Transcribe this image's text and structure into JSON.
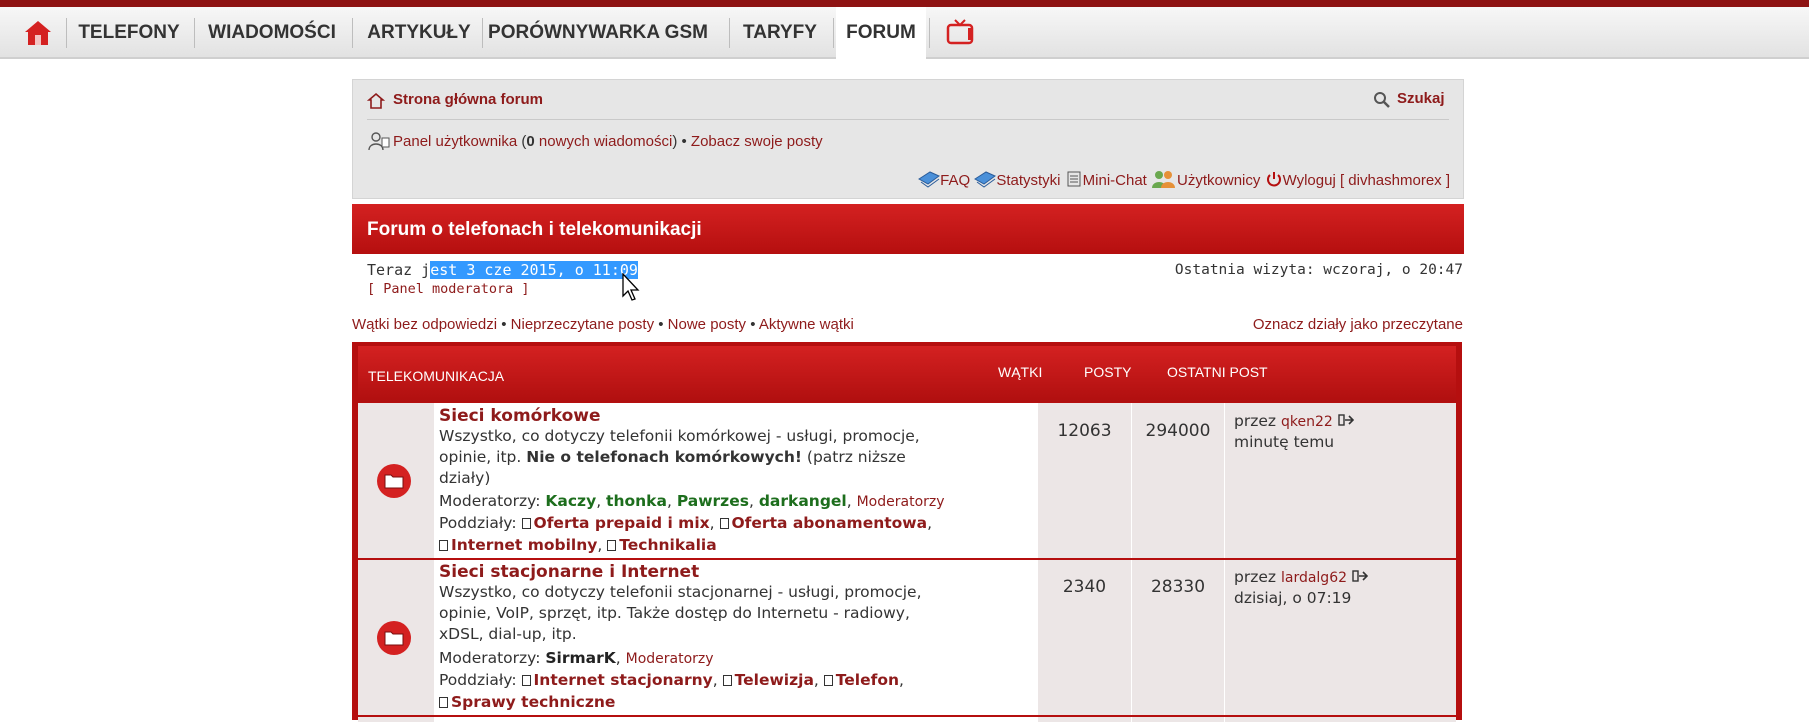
{
  "nav": {
    "items": [
      "TELEFONY",
      "WIADOMOŚCI",
      "ARTYKUŁY",
      "PORÓWNYWARKA GSM",
      "TARYFY",
      "FORUM"
    ],
    "active": "FORUM"
  },
  "header": {
    "home_link": "Strona główna forum",
    "search": "Szukaj",
    "user_panel": "Panel użytkownika",
    "new_messages_count": "0",
    "new_messages_text": "nowych wiadomości",
    "see_posts": "Zobacz swoje posty",
    "faq": "FAQ",
    "stats": "Statystyki",
    "minichat": "Mini-Chat",
    "users": "Użytkownicy",
    "logout": "Wyloguj [ divhashmorex ]"
  },
  "banner": {
    "title": "Forum o telefonach i telekomunikacji"
  },
  "info": {
    "now_prefix": "Teraz j",
    "now_selected": "est 3 cze 2015, o 11:09",
    "moderator_panel": "[ Panel moderatora ]",
    "last_visit": "Ostatnia wizyta: wczoraj, o 20:47"
  },
  "quicklinks": {
    "items": [
      "Wątki bez odpowiedzi",
      "Nieprzeczytane posty",
      "Nowe posty",
      "Aktywne wątki"
    ],
    "mark_read": "Oznacz działy jako przeczytane"
  },
  "table": {
    "category": "TELEKOMUNIKACJA",
    "col_topics": "WĄTKI",
    "col_posts": "POSTY",
    "col_last": "OSTATNI POST",
    "rows": [
      {
        "title": "Sieci komórkowe",
        "desc1": "Wszystko, co dotyczy telefonii komórkowej - usługi, promocje,",
        "desc2a": "opinie, itp. ",
        "desc2b": "Nie o telefonach komórkowych!",
        "desc2c": " (patrz niższe",
        "desc3": "działy)",
        "mod_label": "Moderatorzy:",
        "mods": [
          "Kaczy",
          "thonka",
          "Pawrzes",
          "darkangel"
        ],
        "mod_group": "Moderatorzy",
        "sub_label": "Poddziały:",
        "subs": [
          "Oferta prepaid i mix",
          "Oferta abonamentowa",
          "Internet mobilny",
          "Technikalia"
        ],
        "topics": "12063",
        "posts": "294000",
        "last_by": "przez",
        "last_user": "qken22",
        "last_time": "minutę temu"
      },
      {
        "title": "Sieci stacjonarne i Internet",
        "desc1": "Wszystko, co dotyczy telefonii stacjonarnej - usługi, promocje,",
        "desc2": "opinie, VoIP, sprzęt, itp. Także dostęp do Internetu - radiowy,",
        "desc3": "xDSL, dial-up, itp.",
        "mod_label": "Moderatorzy:",
        "mods": [
          "SirmarK"
        ],
        "mod_group": "Moderatorzy",
        "sub_label": "Poddziały:",
        "subs": [
          "Internet stacjonarny",
          "Telewizja",
          "Telefon",
          "Sprawy techniczne"
        ],
        "topics": "2340",
        "posts": "28330",
        "last_by": "przez",
        "last_user": "lardalg62",
        "last_time": "dzisiaj, o 07:19"
      }
    ]
  },
  "colors": {
    "brand_red": "#b50f0f",
    "link": "#8e1b1b",
    "moderator": "#1d6e1d",
    "selection": "#3399ff"
  }
}
